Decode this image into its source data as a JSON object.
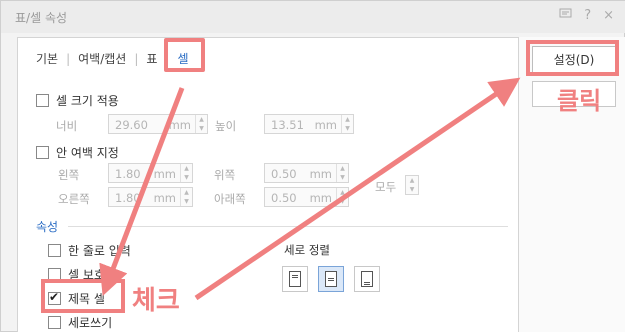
{
  "window": {
    "title": "표/셀 속성",
    "icons": [
      "comment-icon",
      "help-icon",
      "close-icon"
    ],
    "help_glyph": "?",
    "close_glyph": "×"
  },
  "tabs": [
    {
      "label": "기본"
    },
    {
      "label": "여백/캡션"
    },
    {
      "label": "표"
    },
    {
      "label": "셀",
      "active": true
    }
  ],
  "cell_size": {
    "checkbox_label": "셀 크기 적용",
    "width_label": "너비",
    "width_value": "29.60",
    "width_unit": "mm",
    "height_label": "높이",
    "height_value": "13.51",
    "height_unit": "mm"
  },
  "padding": {
    "checkbox_label": "안 여백 지정",
    "left_label": "왼쪽",
    "left_value": "1.80",
    "left_unit": "mm",
    "top_label": "위쪽",
    "top_value": "0.50",
    "top_unit": "mm",
    "right_label": "오른쪽",
    "right_value": "1.80",
    "right_unit": "mm",
    "bottom_label": "아래쪽",
    "bottom_value": "0.50",
    "bottom_unit": "mm",
    "all_label": "모두"
  },
  "properties": {
    "section_title": "속성",
    "items": [
      {
        "label": "한 줄로 입력",
        "checked": false
      },
      {
        "label": "셀 보호",
        "checked": false
      },
      {
        "label": "제목 셀",
        "checked": true
      },
      {
        "label": "세로쓰기",
        "checked": false
      }
    ]
  },
  "vertical_align": {
    "label": "세로 정렬",
    "options": [
      "top",
      "middle",
      "bottom"
    ],
    "selected": "middle"
  },
  "buttons": {
    "settings_label": "설정(D)"
  },
  "annotations": {
    "click_text": "클릭",
    "check_text": "체크",
    "highlight_color": "#f08080"
  },
  "colors": {
    "accent": "#2a6cc4",
    "annotation": "#f08080"
  }
}
